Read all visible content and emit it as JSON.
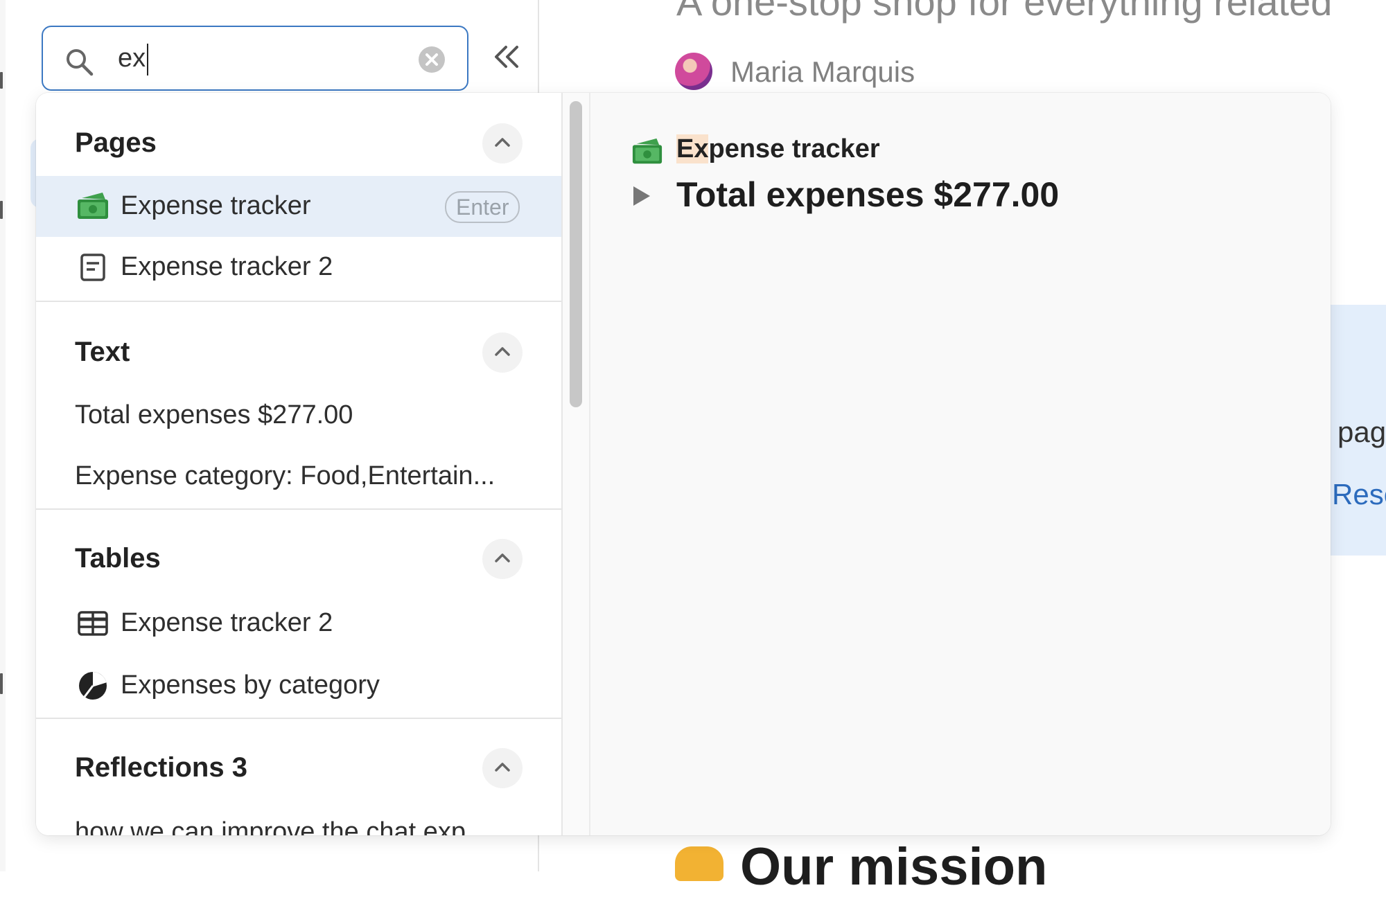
{
  "search": {
    "query": "ex",
    "clear_icon": "clear-circle-icon",
    "search_icon": "search-icon"
  },
  "sidebar": {
    "collapse_icon": "double-chevron-left-icon"
  },
  "main": {
    "subtitle": "A one-stop shop for everything related",
    "author": "Maria Marquis",
    "callout_text": "page",
    "callout_link": "Resc",
    "mission_heading": "Our mission"
  },
  "results": {
    "sections": [
      {
        "title": "Pages",
        "items": [
          {
            "label": "Expense tracker",
            "icon": "money-emoji-icon",
            "shortcut": "Enter",
            "active": true
          },
          {
            "label": "Expense tracker 2",
            "icon": "page-icon"
          }
        ]
      },
      {
        "title": "Text",
        "items": [
          {
            "label": "Total expenses $277.00"
          },
          {
            "label": "Expense category: Food,Entertain..."
          }
        ]
      },
      {
        "title": "Tables",
        "items": [
          {
            "label": "Expense tracker 2",
            "icon": "table-icon"
          },
          {
            "label": "Expenses by category",
            "icon": "pie-chart-icon"
          }
        ]
      },
      {
        "title": "Reflections 3",
        "items": [
          {
            "label": "how we can improve the chat exp..."
          }
        ]
      }
    ]
  },
  "preview": {
    "title_highlight": "Ex",
    "title_rest": "pense tracker",
    "heading": "Total expenses $277.00"
  },
  "colors": {
    "accent": "#3b78c2",
    "selected_row": "#e6eef8",
    "highlight": "#fae2cc",
    "link": "#2c6bbd"
  }
}
